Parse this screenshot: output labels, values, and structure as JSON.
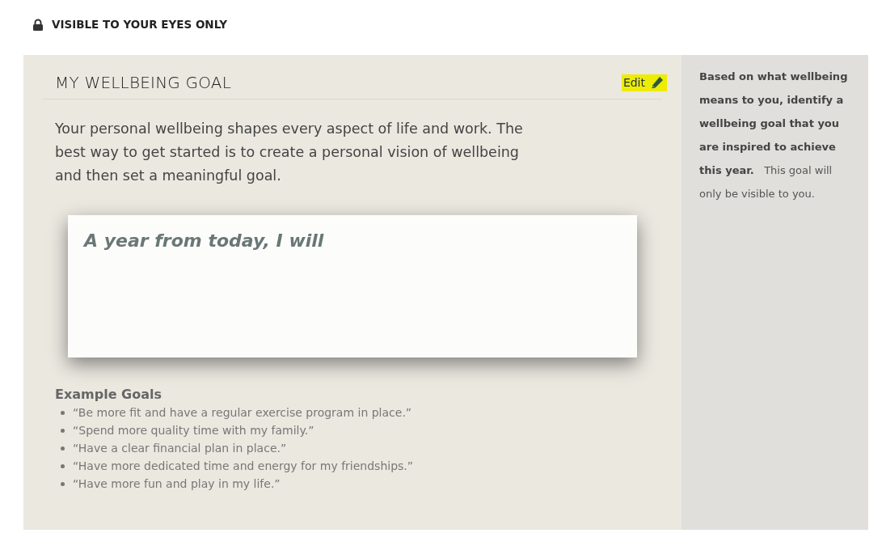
{
  "privacy_notice": "VISIBLE TO YOUR EYES ONLY",
  "goal_panel": {
    "title": "MY WELLBEING GOAL",
    "edit_button": "Edit",
    "intro": "Your personal wellbeing shapes every aspect of life and work. The best way to get started is to create a personal vision of wellbeing and then set a meaningful goal.",
    "goal_field": {
      "placeholder": "A year from today, I will"
    },
    "examples_heading": "Example Goals",
    "examples": [
      "“Be more fit and have a regular exercise program in place.”",
      "“Spend more quality time with my family.”",
      "“Have a clear financial plan in place.”",
      "“Have more dedicated time and energy for my friendships.”",
      "“Have more fun and play in my life.”"
    ]
  },
  "sidebar": {
    "text": "**Based on what wellbeing means to you, identify a wellbeing goal that you are inspired to achieve this year.**   This goal will only be visible to you."
  }
}
